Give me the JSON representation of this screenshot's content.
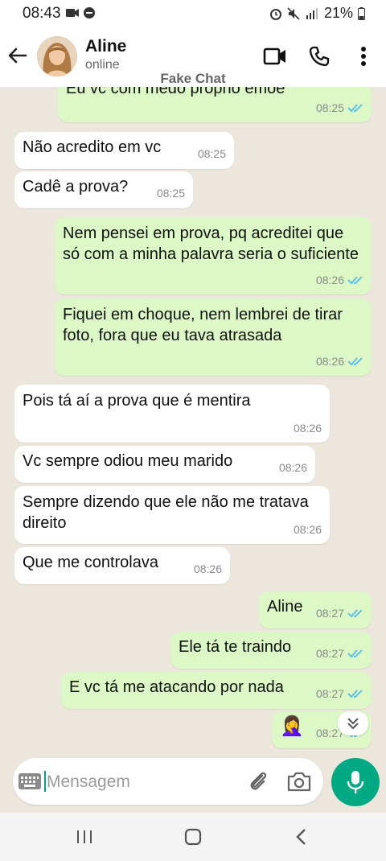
{
  "status_bar": {
    "time": "08:43",
    "battery": "21%"
  },
  "header": {
    "contact_name": "Aline",
    "contact_status": "online"
  },
  "watermark": "Fake Chat",
  "messages": [
    {
      "dir": "out",
      "text": "Eu vc com medo próprio emoe",
      "time": "08:25",
      "read": true
    },
    {
      "dir": "in",
      "text": "Não acredito em vc",
      "time": "08:25"
    },
    {
      "dir": "in",
      "text": "Cadê a prova?",
      "time": "08:25"
    },
    {
      "dir": "out",
      "text": "Nem pensei em prova, pq acreditei que só com a minha palavra seria o suficiente",
      "time": "08:26",
      "read": true
    },
    {
      "dir": "out",
      "text": "Fiquei em choque, nem lembrei de tirar foto, fora que eu tava atrasada",
      "time": "08:26",
      "read": true
    },
    {
      "dir": "in",
      "text": "Pois tá aí a  prova que é mentira",
      "time": "08:26"
    },
    {
      "dir": "in",
      "text": "Vc sempre odiou meu marido",
      "time": "08:26"
    },
    {
      "dir": "in",
      "text": "Sempre dizendo que ele não me tratava direito",
      "time": "08:26"
    },
    {
      "dir": "in",
      "text": "Que me controlava",
      "time": "08:26"
    },
    {
      "dir": "out",
      "text": "Aline",
      "time": "08:27",
      "read": true
    },
    {
      "dir": "out",
      "text": "Ele tá te traindo",
      "time": "08:27",
      "read": true
    },
    {
      "dir": "out",
      "text": "E vc tá me atacando por nada",
      "time": "08:27",
      "read": true
    },
    {
      "dir": "out",
      "text": "🤦‍♀️",
      "time": "08:27",
      "read": true
    }
  ],
  "composer": {
    "placeholder": "Mensagem"
  },
  "colors": {
    "accent": "#00a884",
    "outgoing_bubble": "#dcf8c6",
    "incoming_bubble": "#ffffff",
    "read_ticks": "#53bdeb",
    "chat_background": "#ece6dd"
  },
  "icons": [
    "back-arrow-icon",
    "video-call-icon",
    "phone-icon",
    "more-vert-icon",
    "keyboard-icon",
    "attach-icon",
    "camera-icon",
    "mic-icon",
    "scroll-down-icon"
  ]
}
